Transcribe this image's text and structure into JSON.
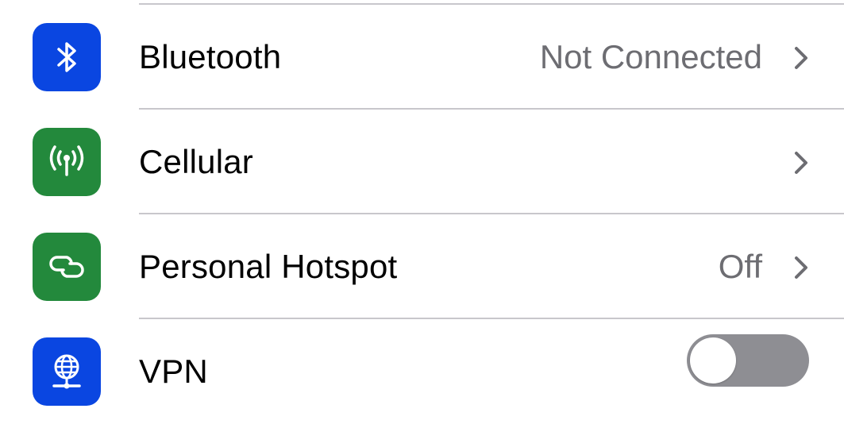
{
  "settings": {
    "rows": [
      {
        "label": "Bluetooth",
        "value": "Not Connected",
        "icon": "bluetooth-icon",
        "icon_color": "#0a46e1",
        "accessory": "chevron"
      },
      {
        "label": "Cellular",
        "value": "",
        "icon": "cellular-antenna-icon",
        "icon_color": "#23893c",
        "accessory": "chevron"
      },
      {
        "label": "Personal Hotspot",
        "value": "Off",
        "icon": "hotspot-link-icon",
        "icon_color": "#23893c",
        "accessory": "chevron"
      },
      {
        "label": "VPN",
        "value": "",
        "icon": "vpn-globe-icon",
        "icon_color": "#0a46e1",
        "accessory": "toggle",
        "toggle_on": false
      }
    ]
  },
  "colors": {
    "blue_icon": "#0a46e1",
    "green_icon": "#23893c",
    "secondary_text": "#6d6d72",
    "separator": "#c8c7cc",
    "toggle_off": "#8e8e93"
  }
}
